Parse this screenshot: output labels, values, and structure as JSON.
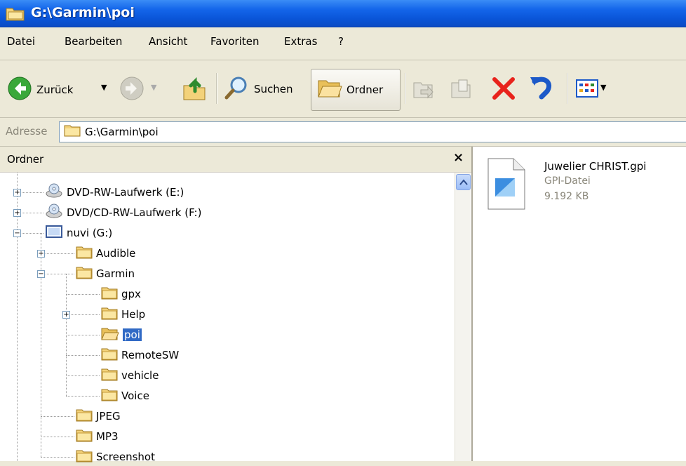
{
  "window": {
    "title": "G:\\Garmin\\poi"
  },
  "menu": [
    "Datei",
    "Bearbeiten",
    "Ansicht",
    "Favoriten",
    "Extras",
    "?"
  ],
  "toolbar": {
    "back_label": "Zurück",
    "search_label": "Suchen",
    "folders_label": "Ordner"
  },
  "address": {
    "label": "Adresse",
    "value": "G:\\Garmin\\poi"
  },
  "folders_pane": {
    "title": "Ordner",
    "close": "×",
    "tree": [
      {
        "label": "DVD-RW-Laufwerk (E:)",
        "icon": "dvd-drive-icon",
        "expander": "plus"
      },
      {
        "label": "DVD/CD-RW-Laufwerk (F:)",
        "icon": "cd-drive-icon",
        "expander": "plus"
      },
      {
        "label": "nuvi (G:)",
        "icon": "removable-drive-icon",
        "expander": "minus"
      },
      {
        "label": "Audible",
        "icon": "folder-icon",
        "expander": "plus"
      },
      {
        "label": "Garmin",
        "icon": "folder-icon",
        "expander": "minus"
      },
      {
        "label": "gpx",
        "icon": "folder-icon",
        "expander": "none"
      },
      {
        "label": "Help",
        "icon": "folder-icon",
        "expander": "plus"
      },
      {
        "label": "poi",
        "icon": "open-folder-icon",
        "expander": "none",
        "selected": true
      },
      {
        "label": "RemoteSW",
        "icon": "folder-icon",
        "expander": "none"
      },
      {
        "label": "vehicle",
        "icon": "folder-icon",
        "expander": "none"
      },
      {
        "label": "Voice",
        "icon": "folder-icon",
        "expander": "none"
      },
      {
        "label": "JPEG",
        "icon": "folder-icon",
        "expander": "none"
      },
      {
        "label": "MP3",
        "icon": "folder-icon",
        "expander": "none"
      },
      {
        "label": "Screenshot",
        "icon": "folder-icon",
        "expander": "none"
      }
    ]
  },
  "file": {
    "name": "Juwelier CHRIST.gpi",
    "type": "GPI-Datei",
    "size": "9.192 KB",
    "icon": "gpi-file-icon"
  },
  "colors": {
    "titlebar": "#0a55d8",
    "selection": "#316ac5",
    "chrome": "#ece9d8",
    "delete_red": "#e8231c"
  }
}
